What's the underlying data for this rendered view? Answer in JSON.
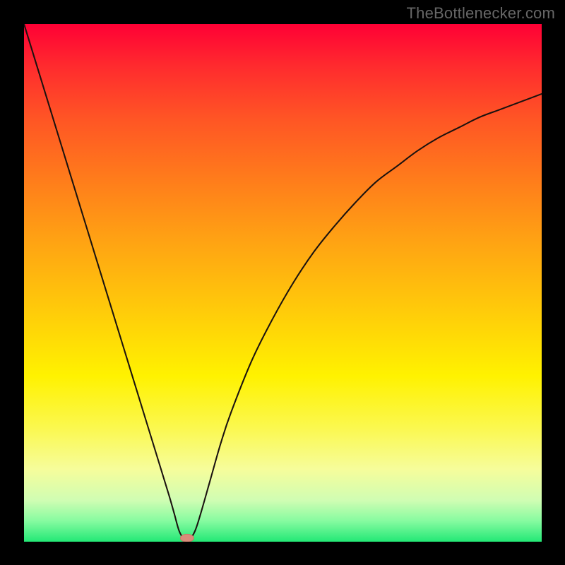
{
  "watermark": {
    "text": "TheBottlenecker.com"
  },
  "plot": {
    "inner_left": 34,
    "inner_top": 34,
    "inner_width": 733,
    "inner_height": 733
  },
  "chart_data": {
    "type": "line",
    "title": "",
    "xlabel": "",
    "ylabel": "",
    "xlim": [
      0,
      100
    ],
    "ylim": [
      0,
      100
    ],
    "grid": false,
    "legend": false,
    "annotations": [],
    "series": [
      {
        "name": "bottleneck-curve",
        "x": [
          0,
          2,
          4,
          6,
          8,
          10,
          12,
          14,
          16,
          18,
          20,
          22,
          24,
          26,
          28,
          29,
          30,
          31,
          32,
          33,
          34,
          36,
          38,
          40,
          44,
          48,
          52,
          56,
          60,
          64,
          68,
          72,
          76,
          80,
          84,
          88,
          92,
          96,
          100
        ],
        "y": [
          100,
          93.5,
          87,
          80.5,
          74,
          67.5,
          61,
          54.5,
          48,
          41.5,
          35,
          28.5,
          22,
          15.5,
          9,
          5.5,
          2.0,
          0.5,
          0.5,
          2.0,
          5,
          12,
          19,
          25,
          35,
          43,
          50,
          56,
          61,
          65.5,
          69.5,
          72.5,
          75.5,
          78,
          80,
          82,
          83.5,
          85,
          86.5
        ]
      }
    ],
    "marker": {
      "name": "min-marker",
      "x": 31.5,
      "y": 0.5,
      "color": "#d98c7a"
    },
    "gradient_stops": [
      {
        "pos": 0,
        "color": "#ff0035"
      },
      {
        "pos": 68,
        "color": "#fff200"
      },
      {
        "pos": 100,
        "color": "#23e876"
      }
    ]
  }
}
